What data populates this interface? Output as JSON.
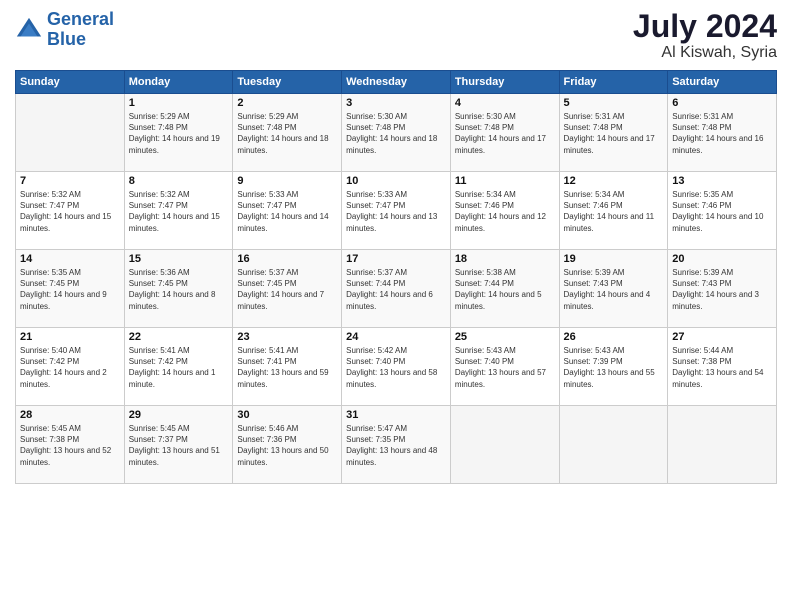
{
  "header": {
    "logo_line1": "General",
    "logo_line2": "Blue",
    "month_year": "July 2024",
    "location": "Al Kiswah, Syria"
  },
  "columns": [
    "Sunday",
    "Monday",
    "Tuesday",
    "Wednesday",
    "Thursday",
    "Friday",
    "Saturday"
  ],
  "weeks": [
    [
      {
        "day": "",
        "sunrise": "",
        "sunset": "",
        "daylight": ""
      },
      {
        "day": "1",
        "sunrise": "Sunrise: 5:29 AM",
        "sunset": "Sunset: 7:48 PM",
        "daylight": "Daylight: 14 hours and 19 minutes."
      },
      {
        "day": "2",
        "sunrise": "Sunrise: 5:29 AM",
        "sunset": "Sunset: 7:48 PM",
        "daylight": "Daylight: 14 hours and 18 minutes."
      },
      {
        "day": "3",
        "sunrise": "Sunrise: 5:30 AM",
        "sunset": "Sunset: 7:48 PM",
        "daylight": "Daylight: 14 hours and 18 minutes."
      },
      {
        "day": "4",
        "sunrise": "Sunrise: 5:30 AM",
        "sunset": "Sunset: 7:48 PM",
        "daylight": "Daylight: 14 hours and 17 minutes."
      },
      {
        "day": "5",
        "sunrise": "Sunrise: 5:31 AM",
        "sunset": "Sunset: 7:48 PM",
        "daylight": "Daylight: 14 hours and 17 minutes."
      },
      {
        "day": "6",
        "sunrise": "Sunrise: 5:31 AM",
        "sunset": "Sunset: 7:48 PM",
        "daylight": "Daylight: 14 hours and 16 minutes."
      }
    ],
    [
      {
        "day": "7",
        "sunrise": "Sunrise: 5:32 AM",
        "sunset": "Sunset: 7:47 PM",
        "daylight": "Daylight: 14 hours and 15 minutes."
      },
      {
        "day": "8",
        "sunrise": "Sunrise: 5:32 AM",
        "sunset": "Sunset: 7:47 PM",
        "daylight": "Daylight: 14 hours and 15 minutes."
      },
      {
        "day": "9",
        "sunrise": "Sunrise: 5:33 AM",
        "sunset": "Sunset: 7:47 PM",
        "daylight": "Daylight: 14 hours and 14 minutes."
      },
      {
        "day": "10",
        "sunrise": "Sunrise: 5:33 AM",
        "sunset": "Sunset: 7:47 PM",
        "daylight": "Daylight: 14 hours and 13 minutes."
      },
      {
        "day": "11",
        "sunrise": "Sunrise: 5:34 AM",
        "sunset": "Sunset: 7:46 PM",
        "daylight": "Daylight: 14 hours and 12 minutes."
      },
      {
        "day": "12",
        "sunrise": "Sunrise: 5:34 AM",
        "sunset": "Sunset: 7:46 PM",
        "daylight": "Daylight: 14 hours and 11 minutes."
      },
      {
        "day": "13",
        "sunrise": "Sunrise: 5:35 AM",
        "sunset": "Sunset: 7:46 PM",
        "daylight": "Daylight: 14 hours and 10 minutes."
      }
    ],
    [
      {
        "day": "14",
        "sunrise": "Sunrise: 5:35 AM",
        "sunset": "Sunset: 7:45 PM",
        "daylight": "Daylight: 14 hours and 9 minutes."
      },
      {
        "day": "15",
        "sunrise": "Sunrise: 5:36 AM",
        "sunset": "Sunset: 7:45 PM",
        "daylight": "Daylight: 14 hours and 8 minutes."
      },
      {
        "day": "16",
        "sunrise": "Sunrise: 5:37 AM",
        "sunset": "Sunset: 7:45 PM",
        "daylight": "Daylight: 14 hours and 7 minutes."
      },
      {
        "day": "17",
        "sunrise": "Sunrise: 5:37 AM",
        "sunset": "Sunset: 7:44 PM",
        "daylight": "Daylight: 14 hours and 6 minutes."
      },
      {
        "day": "18",
        "sunrise": "Sunrise: 5:38 AM",
        "sunset": "Sunset: 7:44 PM",
        "daylight": "Daylight: 14 hours and 5 minutes."
      },
      {
        "day": "19",
        "sunrise": "Sunrise: 5:39 AM",
        "sunset": "Sunset: 7:43 PM",
        "daylight": "Daylight: 14 hours and 4 minutes."
      },
      {
        "day": "20",
        "sunrise": "Sunrise: 5:39 AM",
        "sunset": "Sunset: 7:43 PM",
        "daylight": "Daylight: 14 hours and 3 minutes."
      }
    ],
    [
      {
        "day": "21",
        "sunrise": "Sunrise: 5:40 AM",
        "sunset": "Sunset: 7:42 PM",
        "daylight": "Daylight: 14 hours and 2 minutes."
      },
      {
        "day": "22",
        "sunrise": "Sunrise: 5:41 AM",
        "sunset": "Sunset: 7:42 PM",
        "daylight": "Daylight: 14 hours and 1 minute."
      },
      {
        "day": "23",
        "sunrise": "Sunrise: 5:41 AM",
        "sunset": "Sunset: 7:41 PM",
        "daylight": "Daylight: 13 hours and 59 minutes."
      },
      {
        "day": "24",
        "sunrise": "Sunrise: 5:42 AM",
        "sunset": "Sunset: 7:40 PM",
        "daylight": "Daylight: 13 hours and 58 minutes."
      },
      {
        "day": "25",
        "sunrise": "Sunrise: 5:43 AM",
        "sunset": "Sunset: 7:40 PM",
        "daylight": "Daylight: 13 hours and 57 minutes."
      },
      {
        "day": "26",
        "sunrise": "Sunrise: 5:43 AM",
        "sunset": "Sunset: 7:39 PM",
        "daylight": "Daylight: 13 hours and 55 minutes."
      },
      {
        "day": "27",
        "sunrise": "Sunrise: 5:44 AM",
        "sunset": "Sunset: 7:38 PM",
        "daylight": "Daylight: 13 hours and 54 minutes."
      }
    ],
    [
      {
        "day": "28",
        "sunrise": "Sunrise: 5:45 AM",
        "sunset": "Sunset: 7:38 PM",
        "daylight": "Daylight: 13 hours and 52 minutes."
      },
      {
        "day": "29",
        "sunrise": "Sunrise: 5:45 AM",
        "sunset": "Sunset: 7:37 PM",
        "daylight": "Daylight: 13 hours and 51 minutes."
      },
      {
        "day": "30",
        "sunrise": "Sunrise: 5:46 AM",
        "sunset": "Sunset: 7:36 PM",
        "daylight": "Daylight: 13 hours and 50 minutes."
      },
      {
        "day": "31",
        "sunrise": "Sunrise: 5:47 AM",
        "sunset": "Sunset: 7:35 PM",
        "daylight": "Daylight: 13 hours and 48 minutes."
      },
      {
        "day": "",
        "sunrise": "",
        "sunset": "",
        "daylight": ""
      },
      {
        "day": "",
        "sunrise": "",
        "sunset": "",
        "daylight": ""
      },
      {
        "day": "",
        "sunrise": "",
        "sunset": "",
        "daylight": ""
      }
    ]
  ]
}
